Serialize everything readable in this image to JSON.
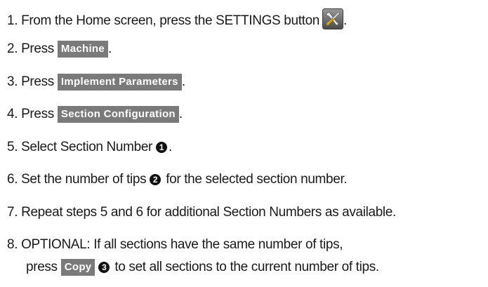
{
  "steps": [
    {
      "prefix": "1. From the Home screen, press the SETTINGS button",
      "icon": "settings-tools-icon",
      "suffix": "."
    },
    {
      "prefix": "2. Press",
      "button": "Machine",
      "suffix": "."
    },
    {
      "prefix": "3. Press",
      "button": "Implement Parameters",
      "suffix": "."
    },
    {
      "prefix": "4. Press",
      "button": "Section Configuration",
      "suffix": "."
    },
    {
      "prefix": "5. Select Section Number",
      "callout": "1",
      "suffix": "."
    },
    {
      "prefix": "6. Set the number of tips",
      "callout": "2",
      "suffix": "for the selected section number."
    },
    {
      "text": "7. Repeat steps 5 and 6 for additional Section Numbers as available."
    },
    {
      "text": "8. OPTIONAL: If all sections have the same number of tips,"
    },
    {
      "prefix": "press",
      "button": "Copy",
      "callout": "3",
      "suffix": "to set all sections to the current number of tips."
    }
  ],
  "colors": {
    "button_bg": "#7a7a7a",
    "button_text": "#ffffff",
    "text": "#1a1a1a",
    "callout_bg": "#111111"
  }
}
